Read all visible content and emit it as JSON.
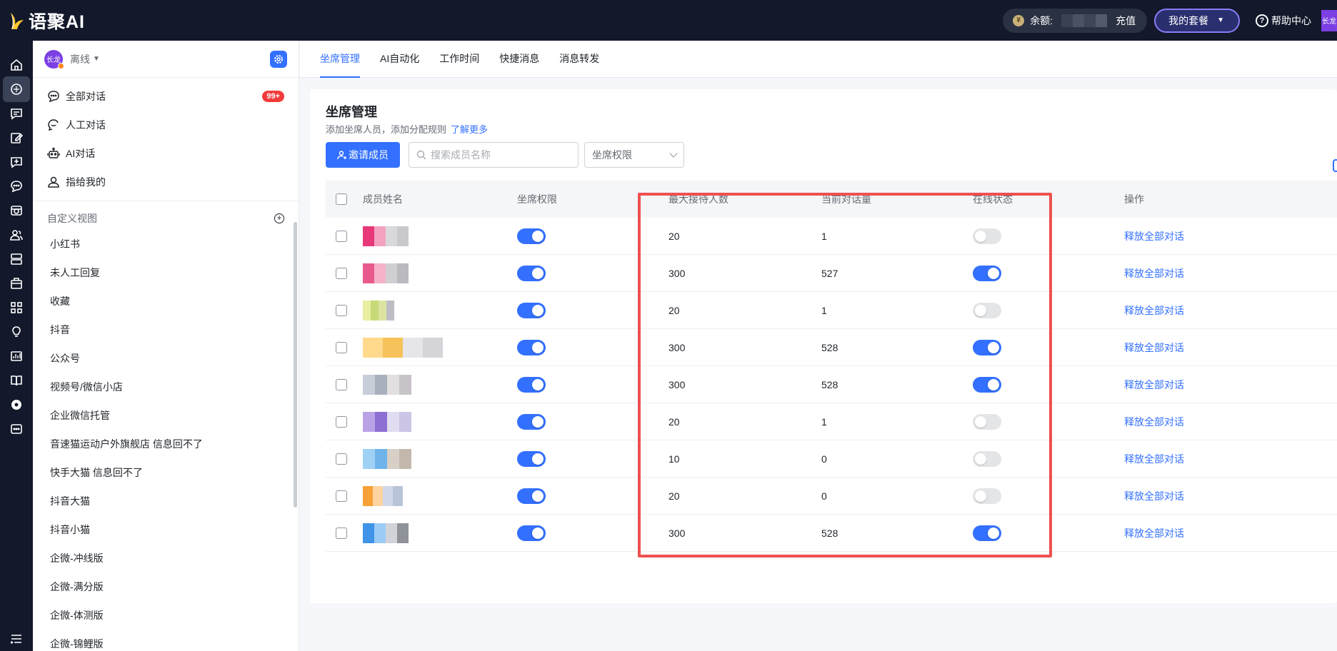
{
  "app": {
    "name": "语聚AI",
    "balance_label": "余额:",
    "recharge_label": "充值",
    "plan_label": "我的套餐",
    "help_label": "帮助中心",
    "user_avatar_text": "长龙"
  },
  "sidebar": {
    "avatar_text": "长龙",
    "status": "离线",
    "conversations": [
      {
        "label": "全部对话",
        "icon": "chat-all-icon",
        "badge": "99+"
      },
      {
        "label": "人工对话",
        "icon": "human-chat-icon",
        "badge": ""
      },
      {
        "label": "AI对话",
        "icon": "robot-icon",
        "badge": ""
      },
      {
        "label": "指给我的",
        "icon": "user-icon",
        "badge": ""
      }
    ],
    "custom_views_title": "自定义视图",
    "views": [
      "小红书",
      "未人工回复",
      "收藏",
      "抖音",
      "公众号",
      "视频号/微信小店",
      "企业微信托管",
      "音速猫运动户外旗舰店 信息回不了",
      "快手大猫 信息回不了",
      "抖音大猫",
      "抖音小猫",
      "企微-冲线版",
      "企微-满分版",
      "企微-体测版",
      "企微-锦鲤版"
    ]
  },
  "tabs": [
    {
      "label": "坐席管理",
      "active": true
    },
    {
      "label": "AI自动化",
      "active": false
    },
    {
      "label": "工作时间",
      "active": false
    },
    {
      "label": "快捷消息",
      "active": false
    },
    {
      "label": "消息转发",
      "active": false
    }
  ],
  "panel": {
    "title": "坐席管理",
    "subtitle": "添加坐席人员，添加分配规则",
    "learn_more": "了解更多",
    "invite_button": "邀请成员",
    "search_placeholder": "搜索成员名称",
    "permission_filter": "坐席权限"
  },
  "table": {
    "columns": [
      "成员姓名",
      "坐席权限",
      "最大接待人数",
      "当前对话量",
      "在线状态",
      "操作"
    ],
    "rows": [
      {
        "seat_permission": true,
        "max_reception": "20",
        "current_conversations": "1",
        "online": false,
        "action": "释放全部对话"
      },
      {
        "seat_permission": true,
        "max_reception": "300",
        "current_conversations": "527",
        "online": true,
        "action": "释放全部对话"
      },
      {
        "seat_permission": true,
        "max_reception": "20",
        "current_conversations": "1",
        "online": false,
        "action": "释放全部对话"
      },
      {
        "seat_permission": true,
        "max_reception": "300",
        "current_conversations": "528",
        "online": true,
        "action": "释放全部对话"
      },
      {
        "seat_permission": true,
        "max_reception": "300",
        "current_conversations": "528",
        "online": true,
        "action": "释放全部对话"
      },
      {
        "seat_permission": true,
        "max_reception": "20",
        "current_conversations": "1",
        "online": false,
        "action": "释放全部对话"
      },
      {
        "seat_permission": true,
        "max_reception": "10",
        "current_conversations": "0",
        "online": false,
        "action": "释放全部对话"
      },
      {
        "seat_permission": true,
        "max_reception": "20",
        "current_conversations": "0",
        "online": false,
        "action": "释放全部对话"
      },
      {
        "seat_permission": true,
        "max_reception": "300",
        "current_conversations": "528",
        "online": true,
        "action": "释放全部对话"
      }
    ]
  },
  "colors": {
    "accent": "#3370ff",
    "topbar": "#13192b",
    "highlight": "#ef5050",
    "badge": "#f23b3b"
  },
  "rail_icons": [
    "home-icon",
    "chat-bubble-icon",
    "message-icon",
    "edit-icon",
    "add-message-icon",
    "comment-icon",
    "inbox-icon",
    "users-icon",
    "server-icon",
    "briefcase-icon",
    "apps-icon",
    "bulb-icon",
    "chart-icon",
    "book-icon",
    "settings-icon",
    "more-icon",
    "menu-icon"
  ]
}
